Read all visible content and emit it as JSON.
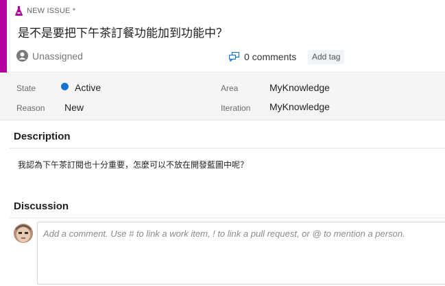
{
  "colors": {
    "accent": "#b4009e",
    "state_active": "#1372d4"
  },
  "header": {
    "type_label": "NEW ISSUE *",
    "type_icon": "issue-flask-icon",
    "title": "是不是要把下午茶訂餐功能加到功能中？",
    "assignee_label": "Unassigned",
    "assignee_icon": "unassigned-avatar-icon",
    "comments_label": "0 comments",
    "comments_icon": "comments-icon",
    "add_tag_label": "Add tag"
  },
  "fields": {
    "state_label": "State",
    "state_value": "Active",
    "reason_label": "Reason",
    "reason_value": "New",
    "area_label": "Area",
    "area_value": "MyKnowledge",
    "iteration_label": "Iteration",
    "iteration_value": "MyKnowledge"
  },
  "description": {
    "heading": "Description",
    "body": "我認為下午茶訂閱也十分重要，怎麼可以不放在開發藍圖中呢？"
  },
  "discussion": {
    "heading": "Discussion",
    "placeholder": "Add a comment. Use # to link a work item, ! to link a pull request, or @ to mention a person."
  }
}
